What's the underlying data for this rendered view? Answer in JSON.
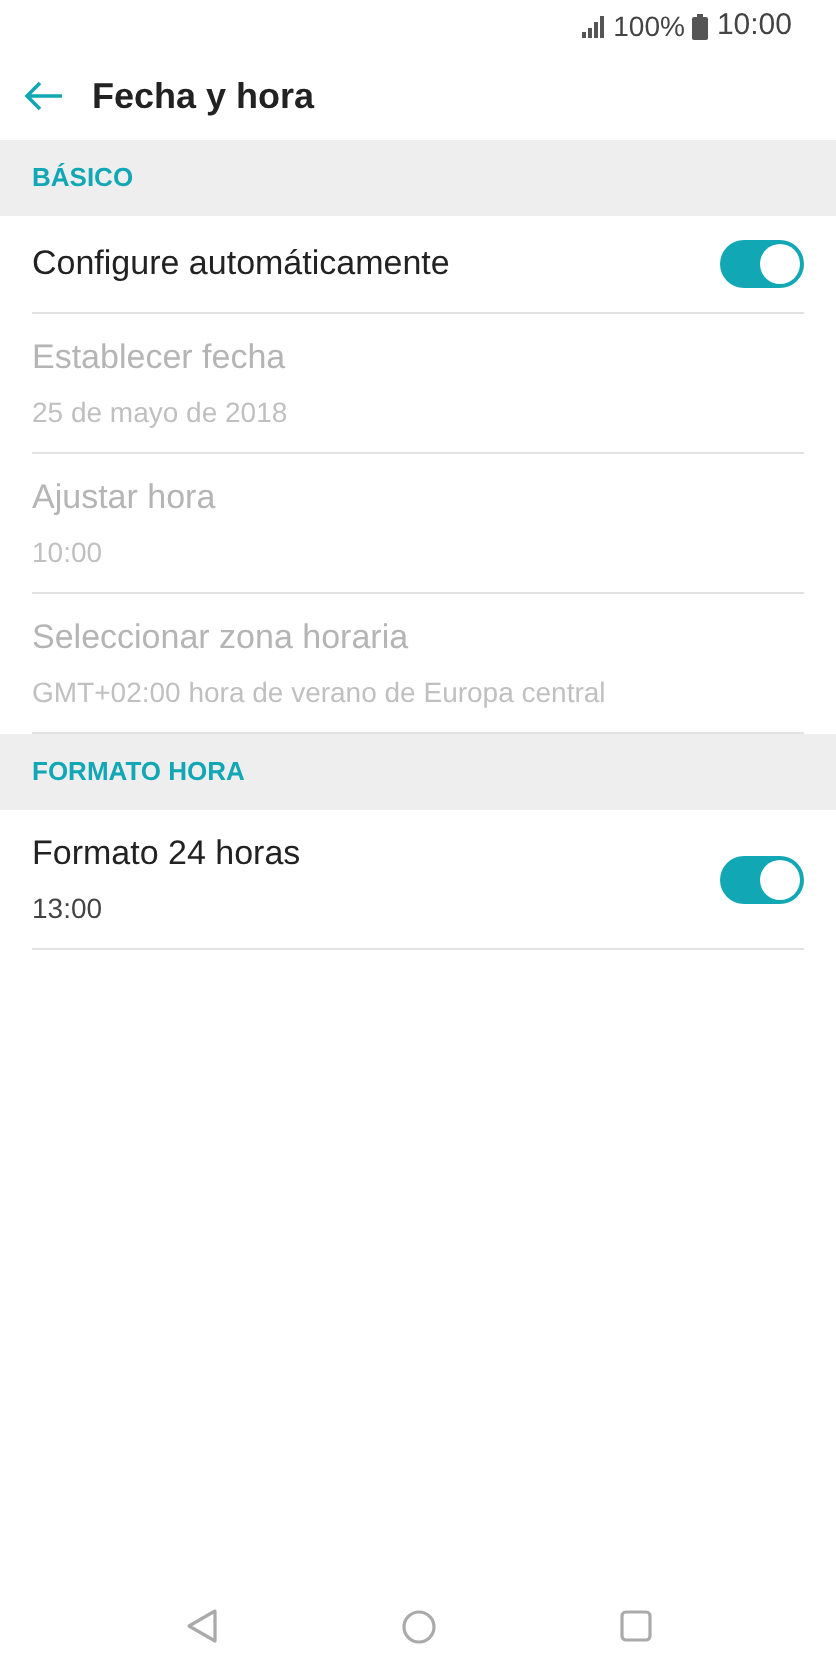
{
  "status_bar": {
    "battery": "100%",
    "time": "10:00"
  },
  "header": {
    "title": "Fecha y hora"
  },
  "sections": [
    {
      "title": "BÁSICO",
      "items": [
        {
          "kind": "toggle",
          "label": "Configure automáticamente",
          "on": true,
          "disabled": false
        },
        {
          "kind": "text",
          "label": "Establecer fecha",
          "summary": "25 de mayo de 2018",
          "disabled": true
        },
        {
          "kind": "text",
          "label": "Ajustar hora",
          "summary": "10:00",
          "disabled": true
        },
        {
          "kind": "text",
          "label": "Seleccionar zona horaria",
          "summary": "GMT+02:00 hora de verano de Europa central",
          "disabled": true
        }
      ]
    },
    {
      "title": "FORMATO HORA",
      "items": [
        {
          "kind": "toggle",
          "label": "Formato 24 horas",
          "summary": "13:00",
          "on": true,
          "disabled": false
        }
      ]
    }
  ]
}
